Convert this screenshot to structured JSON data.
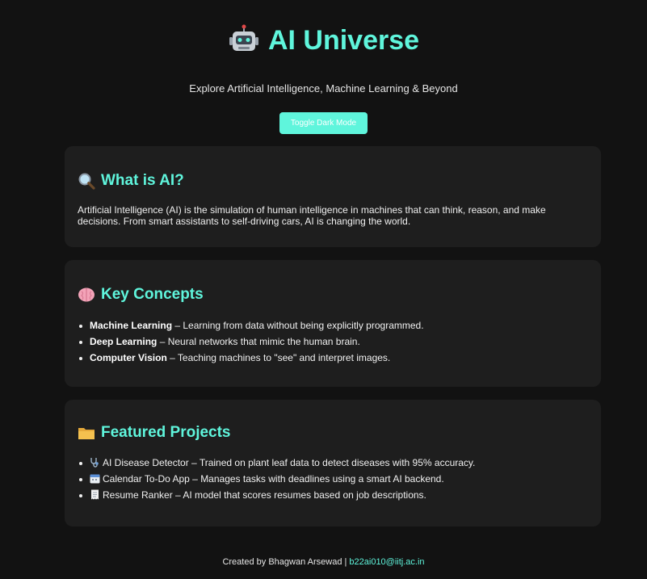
{
  "header": {
    "title": "AI Universe",
    "title_icon": "robot-icon",
    "subtitle": "Explore Artificial Intelligence, Machine Learning & Beyond",
    "toggle_label": "Toggle Dark Mode"
  },
  "sections": {
    "what": {
      "icon": "magnifier-icon",
      "heading": "What is AI?",
      "body": "Artificial Intelligence (AI) is the simulation of human intelligence in machines that can think, reason, and make decisions. From smart assistants to self-driving cars, AI is changing the world."
    },
    "concepts": {
      "icon": "brain-icon",
      "heading": "Key Concepts",
      "items": [
        {
          "term": "Machine Learning",
          "desc": "– Learning from data without being explicitly programmed."
        },
        {
          "term": "Deep Learning",
          "desc": "– Neural networks that mimic the human brain."
        },
        {
          "term": "Computer Vision",
          "desc": "– Teaching machines to \"see\" and interpret images."
        }
      ]
    },
    "projects": {
      "icon": "folder-icon",
      "heading": "Featured Projects",
      "items": [
        {
          "icon": "stethoscope-icon",
          "text": "AI Disease Detector – Trained on plant leaf data to detect diseases with 95% accuracy."
        },
        {
          "icon": "calendar-icon",
          "text": "Calendar To-Do App – Manages tasks with deadlines using a smart AI backend."
        },
        {
          "icon": "receipt-icon",
          "text": "Resume Ranker – AI model that scores resumes based on job descriptions."
        }
      ]
    }
  },
  "footer": {
    "credit": "Created by Bhagwan Arsewad | ",
    "email": "b22ai010@iitj.ac.in"
  },
  "colors": {
    "accent": "#5ff5dc",
    "background": "#121212",
    "card": "#1e1e1e"
  }
}
